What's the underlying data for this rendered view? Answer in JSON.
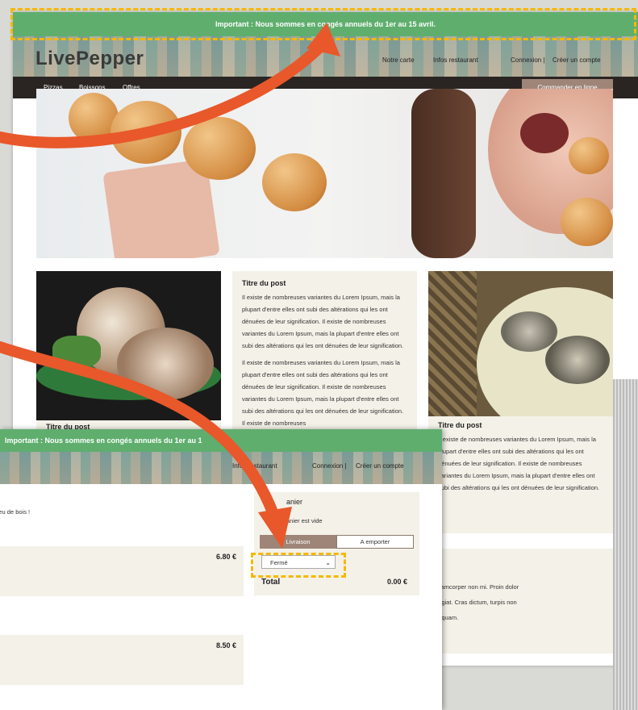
{
  "announcement": "Important : Nous sommes en congés annuels du 1er au 15 avril.",
  "announcement_cut": "Important : Nous sommes en congés annuels du 1er au 1",
  "logo": "LivePepper",
  "nav": {
    "carte": "Notre carte",
    "infos": "Infos restaurant",
    "connexion": "Connexion |",
    "creer": "Créer un compte",
    "infos_cut": "Infos restaurant"
  },
  "categories": [
    "Pizzas",
    "Boissons",
    "Offres"
  ],
  "order_button": "Commander en ligne",
  "posts": [
    {
      "title": "Titre du post",
      "para1": "Il existe de nombreuses variantes du Lorem Ipsum, mais la plupart d'entre elles ont subi des altérations qui les ont dénuées de leur signification. Il existe de nombreuses variantes du Lorem Ipsum, mais la plupart d'entre elles ont subi des altérations qui les ont dénuées de leur signification.",
      "para2": "Il existe de nombreuses variantes du Lorem Ipsum, mais la plupart d'entre elles ont subi des altérations qui les ont dénuées de leur signification. Il existe de nombreuses variantes du Lorem Ipsum, mais la plupart d'entre elles ont subi des altérations qui les ont dénuées de leur signification. Il existe de nombreuses"
    },
    {
      "title": "Titre du post",
      "text": "Il existe de nombreuses variantes du Lorem Ipsum, mais la plupart d'entre elles ont subi des altérations qui les ont dénuées de leur signification. Il existe de nombreuses variantes du Lorem Ipsum, mais la plupart d'entre elles ont subi des altérations qui les ont dénuées de leur signification."
    },
    {
      "title": "Titre du post"
    }
  ],
  "lorem_fragment": [
    "ullamcorper non mi. Proin dolor",
    "eugiat. Cras dictum, turpis non",
    "ut quam."
  ],
  "overlay": {
    "tagline": "u feu de bois !",
    "price1": "6.80 €",
    "price2": "8.50 €",
    "cart_title": "anier",
    "cart_empty": "anier est vide",
    "tab_delivery": "Livraison",
    "tab_takeaway": "A emporter",
    "select_value": "Fermé",
    "total_label": "Total",
    "total_value": "0.00 €"
  },
  "colors": {
    "announce": "#5fae6e",
    "dark": "#2a2522",
    "accent": "#9e8578",
    "beige": "#f4f1e8",
    "arrow": "#e8582a",
    "highlight": "#f5b800"
  }
}
